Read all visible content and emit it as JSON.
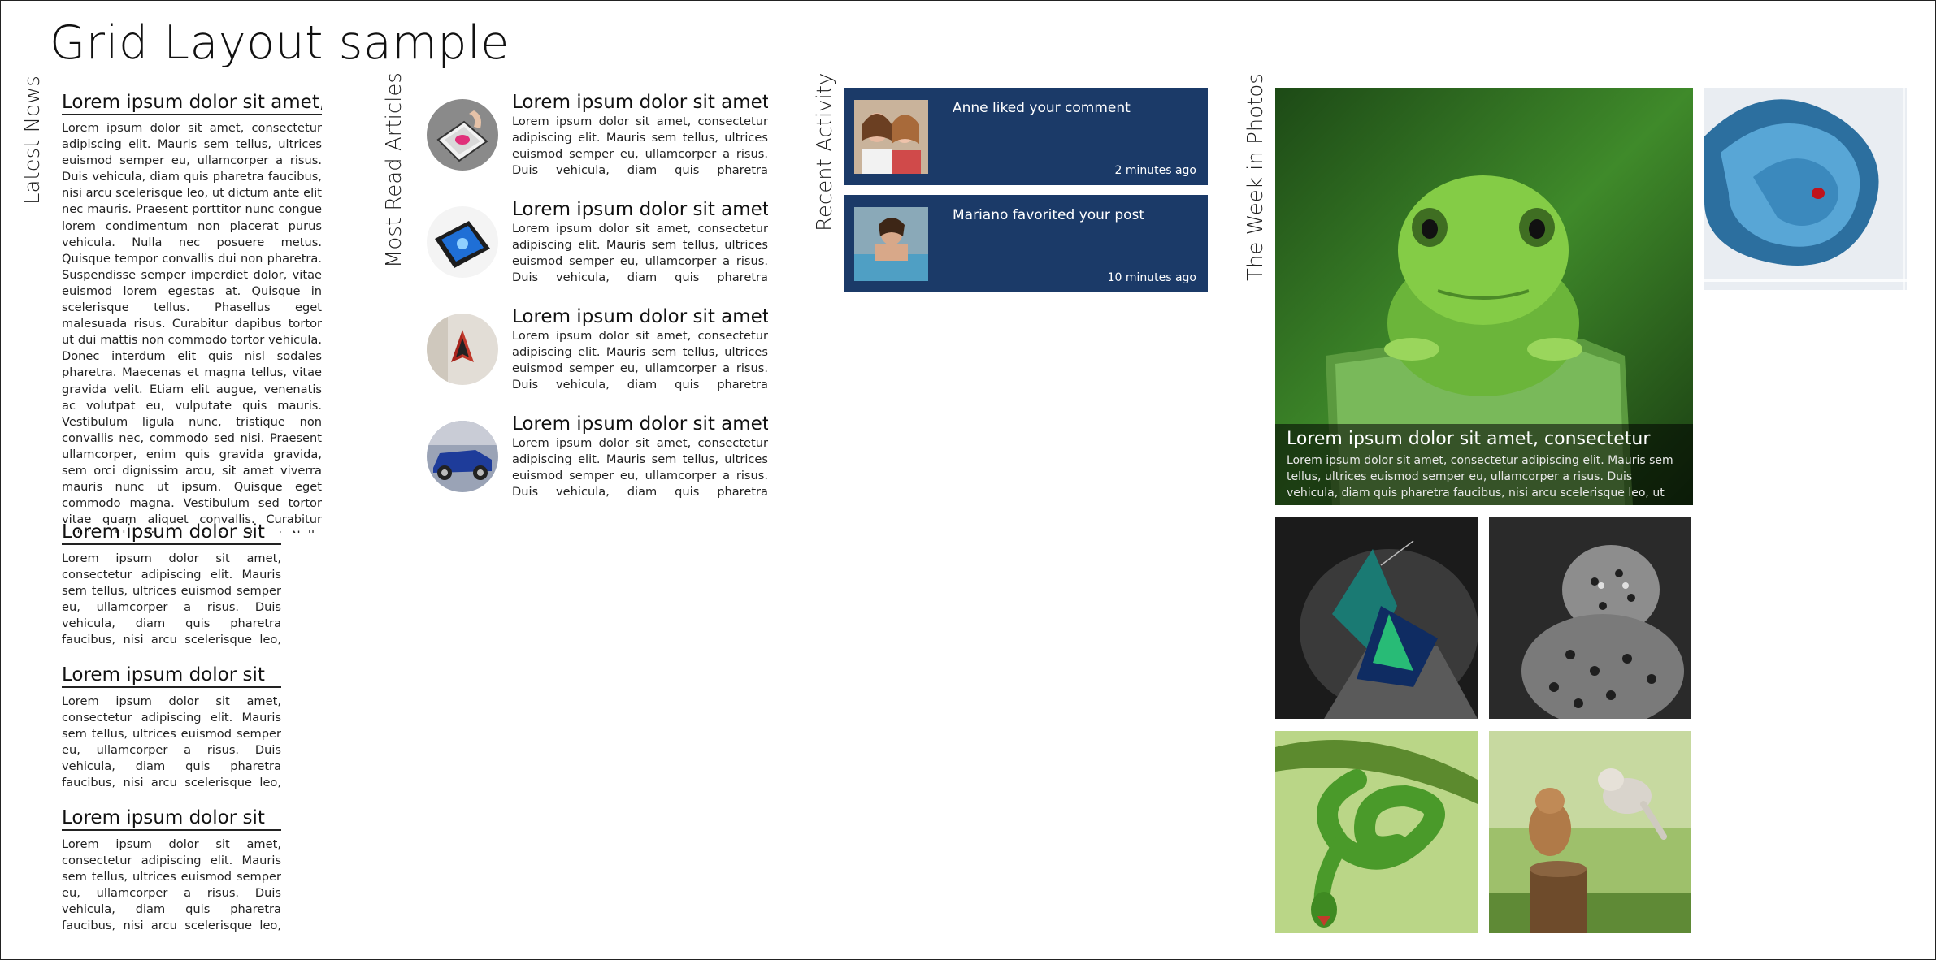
{
  "page": {
    "title": "Grid Layout sample"
  },
  "groups": {
    "latest_news": "Latest News",
    "most_read": "Most Read Articles",
    "recent_activity": "Recent Activity",
    "photos": "The Week in Photos"
  },
  "latest_news": {
    "main": {
      "title": "Lorem ipsum dolor sit amet,",
      "body": "Lorem ipsum dolor sit amet, consectetur adipiscing elit. Mauris sem tellus, ultrices euismod semper eu, ullamcorper a risus. Duis vehicula, diam quis pharetra faucibus, nisi arcu scelerisque leo, ut dictum ante elit nec mauris. Praesent porttitor nunc congue lorem condimentum non placerat purus vehicula. Nulla nec posuere metus. Quisque tempor convallis dui non pharetra. Suspendisse semper imperdiet dolor, vitae euismod lorem egestas at. Quisque in scelerisque tellus. Phasellus eget malesuada risus. Curabitur dapibus tortor ut dui mattis non commodo tortor vehicula. Donec interdum elit quis nisl sodales pharetra. Maecenas et magna tellus, vitae gravida velit. Etiam elit augue, venenatis ac volutpat eu, vulputate quis mauris. Vestibulum ligula nunc, tristique non convallis nec, commodo sed nisi. Praesent ullamcorper, enim quis gravida gravida, sem orci dignissim arcu, sit amet viverra mauris nunc ut ipsum. Quisque eget commodo magna. Vestibulum sed tortor vitae quam aliquet convallis. Curabitur pulvinar blandit neque luctus aliquet. Nulla facilisi. Maecenas vitae nisl eu lacus aliquet"
    },
    "items": [
      {
        "title": "Lorem ipsum dolor sit",
        "body": "Lorem ipsum dolor sit amet, consectetur adipiscing elit. Mauris sem tellus, ultrices euismod semper eu, ullamcorper a risus. Duis vehicula, diam quis pharetra faucibus, nisi arcu scelerisque leo, ut dictum ante elit nec mauris. Praesent"
      },
      {
        "title": "Lorem ipsum dolor sit",
        "body": "Lorem ipsum dolor sit amet, consectetur adipiscing elit. Mauris sem tellus, ultrices euismod semper eu, ullamcorper a risus. Duis vehicula, diam quis pharetra faucibus, nisi arcu scelerisque leo, ut dictum ante elit nec mauris. Praesent"
      },
      {
        "title": "Lorem ipsum dolor sit",
        "body": "Lorem ipsum dolor sit amet, consectetur adipiscing elit. Mauris sem tellus, ultrices euismod semper eu, ullamcorper a risus. Duis vehicula, diam quis pharetra faucibus, nisi arcu scelerisque leo, ut dictum ante elit nec mauris. Praesent"
      }
    ]
  },
  "most_read": [
    {
      "title": "Lorem ipsum dolor sit amet,",
      "body": "Lorem ipsum dolor sit amet, consectetur adipiscing elit. Mauris sem tellus, ultrices euismod semper eu, ullamcorper a risus. Duis vehicula, diam quis pharetra faucibus, nisi arcu",
      "thumb": "tablet-photo"
    },
    {
      "title": "Lorem ipsum dolor sit amet,",
      "body": "Lorem ipsum dolor sit amet, consectetur adipiscing elit. Mauris sem tellus, ultrices euismod semper eu, ullamcorper a risus. Duis vehicula, diam quis pharetra faucibus, nisi arcu",
      "thumb": "windows-tablet-photo"
    },
    {
      "title": "Lorem ipsum dolor sit amet,",
      "body": "Lorem ipsum dolor sit amet, consectetur adipiscing elit. Mauris sem tellus, ultrices euismod semper eu, ullamcorper a risus. Duis vehicula, diam quis pharetra faucibus, nisi arcu",
      "thumb": "butterfly-photo"
    },
    {
      "title": "Lorem ipsum dolor sit amet,",
      "body": "Lorem ipsum dolor sit amet, consectetur adipiscing elit. Mauris sem tellus, ultrices euismod semper eu, ullamcorper a risus. Duis vehicula, diam quis pharetra faucibus, nisi arcu",
      "thumb": "blue-car-photo"
    }
  ],
  "recent_activity": [
    {
      "text": "Anne liked your comment",
      "time": "2 minutes ago",
      "thumb": "friends-photo"
    },
    {
      "text": "Mariano favorited your post",
      "time": "10 minutes ago",
      "thumb": "pool-photo"
    }
  ],
  "photos": {
    "featured": {
      "title": "Lorem ipsum dolor sit amet, consectetur",
      "text": "Lorem ipsum dolor sit amet, consectetur adipiscing elit. Mauris sem tellus, ultrices euismod semper eu, ullamcorper a risus. Duis vehicula, diam quis pharetra faucibus, nisi arcu scelerisque leo, ut dictum ante elit nec mauris.",
      "image": "green-frog-photo"
    },
    "tiles": [
      "blue-snake-photo",
      "butterfly-photo",
      "leopard-photo",
      "green-snake-photo",
      "kittens-photo"
    ]
  },
  "colors": {
    "activity_bg": "#1b3a68",
    "text": "#111111",
    "background": "#ffffff"
  }
}
